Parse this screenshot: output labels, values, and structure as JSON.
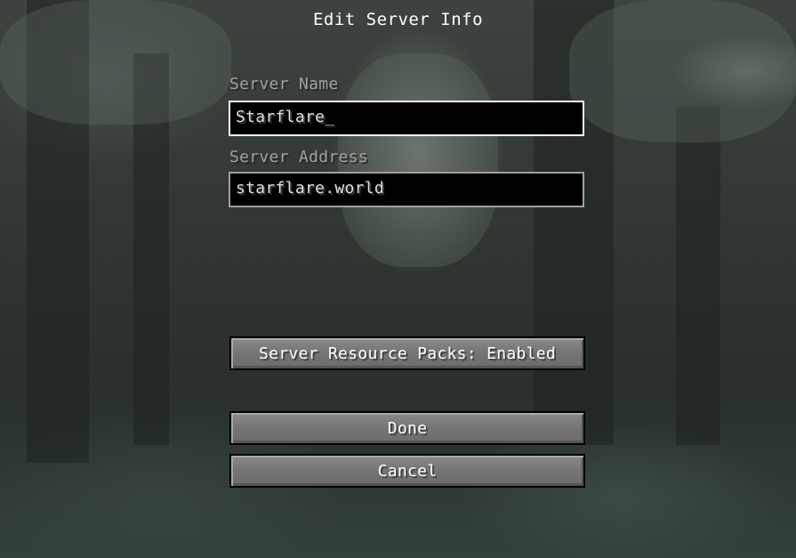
{
  "screen": {
    "title": "Edit Server Info"
  },
  "server_name": {
    "label": "Server Name",
    "value": "Starflare",
    "caret": "_"
  },
  "server_address": {
    "label": "Server Address",
    "value": "starflare.world"
  },
  "buttons": {
    "resource_packs": "Server Resource Packs: Enabled",
    "done": "Done",
    "cancel": "Cancel"
  },
  "colors": {
    "label_gray": "#a0a0a0",
    "field_border_focused": "#ffffff",
    "field_border": "#a0a0a0",
    "field_bg": "#000000",
    "button_face": "#6f6f6f"
  },
  "icons": {
    "background": "blurred-forest-panorama"
  }
}
